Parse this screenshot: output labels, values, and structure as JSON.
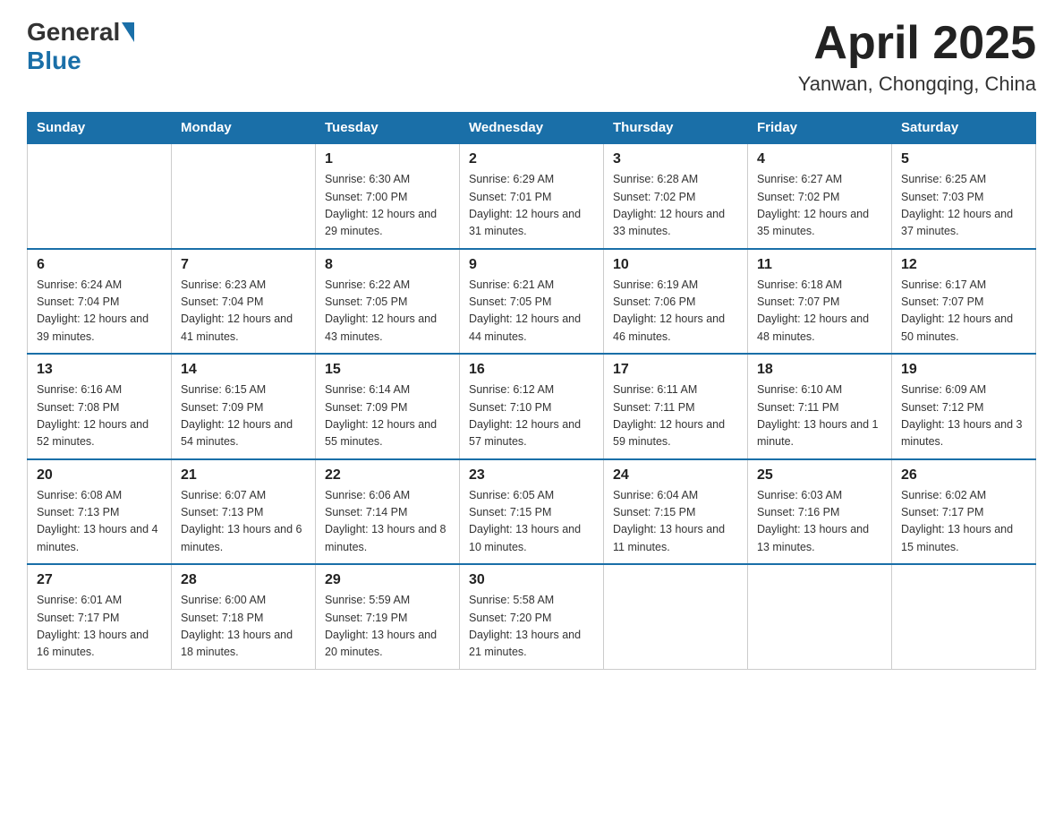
{
  "header": {
    "logo": {
      "general": "General",
      "blue": "Blue"
    },
    "title": "April 2025",
    "subtitle": "Yanwan, Chongqing, China"
  },
  "days_of_week": [
    "Sunday",
    "Monday",
    "Tuesday",
    "Wednesday",
    "Thursday",
    "Friday",
    "Saturday"
  ],
  "weeks": [
    [
      {
        "day": "",
        "info": ""
      },
      {
        "day": "",
        "info": ""
      },
      {
        "day": "1",
        "info": "Sunrise: 6:30 AM\nSunset: 7:00 PM\nDaylight: 12 hours\nand 29 minutes."
      },
      {
        "day": "2",
        "info": "Sunrise: 6:29 AM\nSunset: 7:01 PM\nDaylight: 12 hours\nand 31 minutes."
      },
      {
        "day": "3",
        "info": "Sunrise: 6:28 AM\nSunset: 7:02 PM\nDaylight: 12 hours\nand 33 minutes."
      },
      {
        "day": "4",
        "info": "Sunrise: 6:27 AM\nSunset: 7:02 PM\nDaylight: 12 hours\nand 35 minutes."
      },
      {
        "day": "5",
        "info": "Sunrise: 6:25 AM\nSunset: 7:03 PM\nDaylight: 12 hours\nand 37 minutes."
      }
    ],
    [
      {
        "day": "6",
        "info": "Sunrise: 6:24 AM\nSunset: 7:04 PM\nDaylight: 12 hours\nand 39 minutes."
      },
      {
        "day": "7",
        "info": "Sunrise: 6:23 AM\nSunset: 7:04 PM\nDaylight: 12 hours\nand 41 minutes."
      },
      {
        "day": "8",
        "info": "Sunrise: 6:22 AM\nSunset: 7:05 PM\nDaylight: 12 hours\nand 43 minutes."
      },
      {
        "day": "9",
        "info": "Sunrise: 6:21 AM\nSunset: 7:05 PM\nDaylight: 12 hours\nand 44 minutes."
      },
      {
        "day": "10",
        "info": "Sunrise: 6:19 AM\nSunset: 7:06 PM\nDaylight: 12 hours\nand 46 minutes."
      },
      {
        "day": "11",
        "info": "Sunrise: 6:18 AM\nSunset: 7:07 PM\nDaylight: 12 hours\nand 48 minutes."
      },
      {
        "day": "12",
        "info": "Sunrise: 6:17 AM\nSunset: 7:07 PM\nDaylight: 12 hours\nand 50 minutes."
      }
    ],
    [
      {
        "day": "13",
        "info": "Sunrise: 6:16 AM\nSunset: 7:08 PM\nDaylight: 12 hours\nand 52 minutes."
      },
      {
        "day": "14",
        "info": "Sunrise: 6:15 AM\nSunset: 7:09 PM\nDaylight: 12 hours\nand 54 minutes."
      },
      {
        "day": "15",
        "info": "Sunrise: 6:14 AM\nSunset: 7:09 PM\nDaylight: 12 hours\nand 55 minutes."
      },
      {
        "day": "16",
        "info": "Sunrise: 6:12 AM\nSunset: 7:10 PM\nDaylight: 12 hours\nand 57 minutes."
      },
      {
        "day": "17",
        "info": "Sunrise: 6:11 AM\nSunset: 7:11 PM\nDaylight: 12 hours\nand 59 minutes."
      },
      {
        "day": "18",
        "info": "Sunrise: 6:10 AM\nSunset: 7:11 PM\nDaylight: 13 hours\nand 1 minute."
      },
      {
        "day": "19",
        "info": "Sunrise: 6:09 AM\nSunset: 7:12 PM\nDaylight: 13 hours\nand 3 minutes."
      }
    ],
    [
      {
        "day": "20",
        "info": "Sunrise: 6:08 AM\nSunset: 7:13 PM\nDaylight: 13 hours\nand 4 minutes."
      },
      {
        "day": "21",
        "info": "Sunrise: 6:07 AM\nSunset: 7:13 PM\nDaylight: 13 hours\nand 6 minutes."
      },
      {
        "day": "22",
        "info": "Sunrise: 6:06 AM\nSunset: 7:14 PM\nDaylight: 13 hours\nand 8 minutes."
      },
      {
        "day": "23",
        "info": "Sunrise: 6:05 AM\nSunset: 7:15 PM\nDaylight: 13 hours\nand 10 minutes."
      },
      {
        "day": "24",
        "info": "Sunrise: 6:04 AM\nSunset: 7:15 PM\nDaylight: 13 hours\nand 11 minutes."
      },
      {
        "day": "25",
        "info": "Sunrise: 6:03 AM\nSunset: 7:16 PM\nDaylight: 13 hours\nand 13 minutes."
      },
      {
        "day": "26",
        "info": "Sunrise: 6:02 AM\nSunset: 7:17 PM\nDaylight: 13 hours\nand 15 minutes."
      }
    ],
    [
      {
        "day": "27",
        "info": "Sunrise: 6:01 AM\nSunset: 7:17 PM\nDaylight: 13 hours\nand 16 minutes."
      },
      {
        "day": "28",
        "info": "Sunrise: 6:00 AM\nSunset: 7:18 PM\nDaylight: 13 hours\nand 18 minutes."
      },
      {
        "day": "29",
        "info": "Sunrise: 5:59 AM\nSunset: 7:19 PM\nDaylight: 13 hours\nand 20 minutes."
      },
      {
        "day": "30",
        "info": "Sunrise: 5:58 AM\nSunset: 7:20 PM\nDaylight: 13 hours\nand 21 minutes."
      },
      {
        "day": "",
        "info": ""
      },
      {
        "day": "",
        "info": ""
      },
      {
        "day": "",
        "info": ""
      }
    ]
  ]
}
